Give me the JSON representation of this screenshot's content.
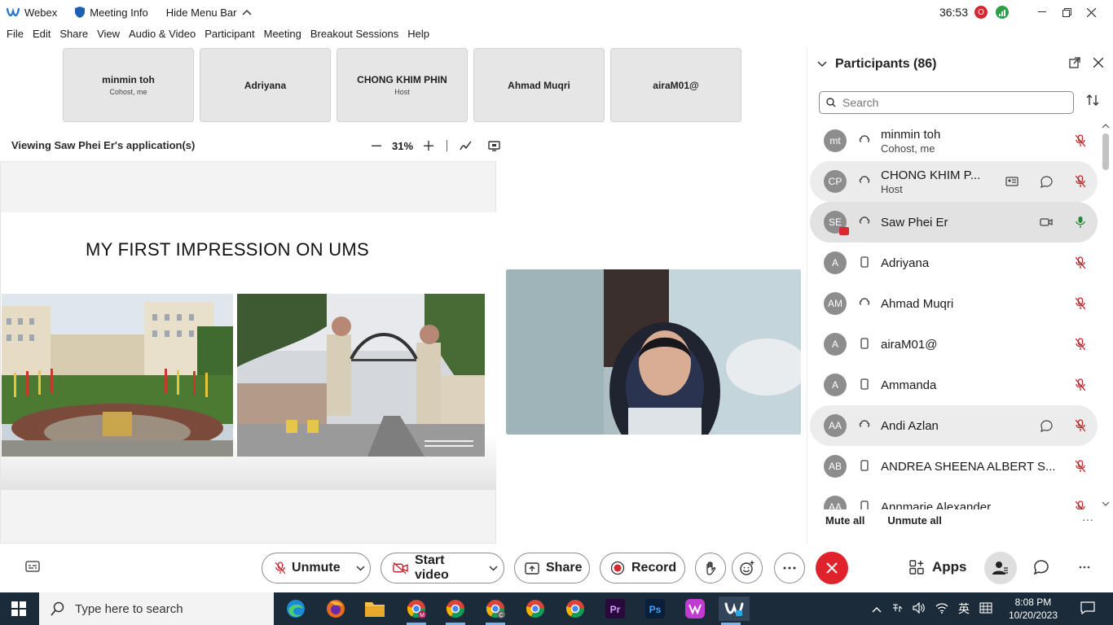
{
  "titlebar": {
    "app_name": "Webex",
    "meeting_info": "Meeting Info",
    "hide_menu": "Hide Menu Bar",
    "timer": "36:53",
    "rec_badge": "O"
  },
  "menu": [
    "File",
    "Edit",
    "Share",
    "View",
    "Audio & Video",
    "Participant",
    "Meeting",
    "Breakout Sessions",
    "Help"
  ],
  "tiles": [
    {
      "name": "minmin toh",
      "role": "Cohost, me"
    },
    {
      "name": "Adriyana",
      "role": ""
    },
    {
      "name": "CHONG KHIM PHIN",
      "role": "Host"
    },
    {
      "name": "Ahmad Muqri",
      "role": ""
    },
    {
      "name": "airaM01@",
      "role": ""
    }
  ],
  "viewing": {
    "label": "Viewing Saw Phei Er's application(s)",
    "zoom": "31%"
  },
  "slide": {
    "title": "MY FIRST IMPRESSION ON UMS"
  },
  "panel": {
    "title": "Participants (86)",
    "search_placeholder": "Search",
    "mute_all": "Mute all",
    "unmute_all": "Unmute all"
  },
  "participants": [
    {
      "initials": "mt",
      "name": "minmin toh",
      "role": "Cohost, me"
    },
    {
      "initials": "CP",
      "name": "CHONG KHIM P...",
      "role": "Host"
    },
    {
      "initials": "SE",
      "name": "Saw Phei Er",
      "role": ""
    },
    {
      "initials": "A",
      "name": "Adriyana",
      "role": ""
    },
    {
      "initials": "AM",
      "name": "Ahmad Muqri",
      "role": ""
    },
    {
      "initials": "A",
      "name": "airaM01@",
      "role": ""
    },
    {
      "initials": "A",
      "name": "Ammanda",
      "role": ""
    },
    {
      "initials": "AA",
      "name": "Andi Azlan",
      "role": ""
    },
    {
      "initials": "AB",
      "name": "ANDREA SHEENA ALBERT S...",
      "role": ""
    },
    {
      "initials": "AA",
      "name": "Annmarie Alexander",
      "role": ""
    }
  ],
  "controls": {
    "unmute": "Unmute",
    "start_video": "Start video",
    "share": "Share",
    "record": "Record",
    "apps": "Apps"
  },
  "taskbar": {
    "search_placeholder": "Type here to search",
    "time": "8:08 PM",
    "date": "10/20/2023",
    "ime": "英"
  },
  "colors": {
    "leave_red": "#e0222c",
    "muted_red": "#c4262e",
    "unmuted_green": "#1f8a3a",
    "taskbar": "#1c2b3a"
  }
}
